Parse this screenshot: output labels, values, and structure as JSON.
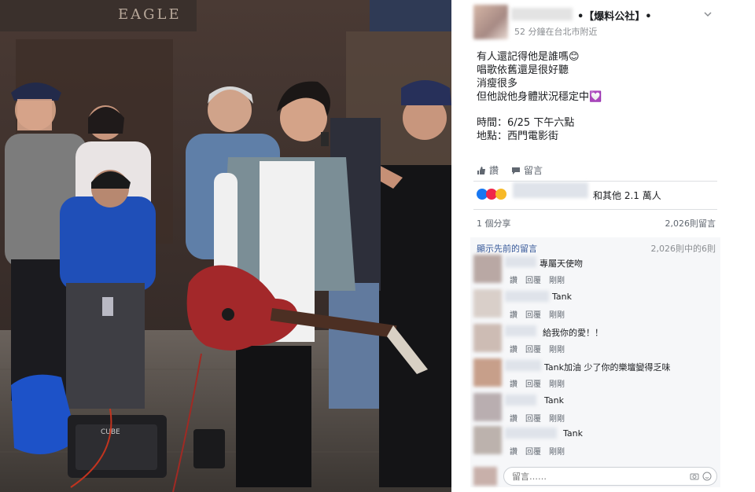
{
  "post": {
    "page_name": "•【爆料公社】•",
    "meta": "52 分鐘在台北市附近",
    "body_lines": [
      "有人還記得他是誰嗎😊",
      "唱歌依舊還是很好聽",
      "消瘦很多",
      "但他說他身體狀況穩定中💟"
    ],
    "event_lines": [
      "時間：6/25 下午六點",
      "地點：西門電影街"
    ],
    "actions": {
      "like": "讚",
      "comment": "留言"
    },
    "reactions_text": "和其他 2.1 萬人",
    "shares": "1 個分享",
    "comment_count": "2,026則留言",
    "previous_comments_link": "顯示先前的留言",
    "comment_progress": "2,026則中的6則",
    "comments": [
      {
        "text": "專屬天使吻"
      },
      {
        "text": "Tank"
      },
      {
        "text": "給我你的愛！！"
      },
      {
        "text": "Tank加油 少了你的樂壇變得乏味"
      },
      {
        "text": "Tank"
      },
      {
        "text": "Tank"
      }
    ],
    "comment_action_labels": [
      "讚",
      "回覆",
      "剛剛"
    ],
    "input_placeholder": "留言……"
  },
  "photo": {
    "sign_text": "EAGLE",
    "amp_brand": "CUBE"
  },
  "colors": {
    "facebook_link": "#365899",
    "reaction_like": "#1877f2",
    "reaction_love": "#f0284a",
    "reaction_haha": "#f7b928",
    "guitar_red": "#a3282a",
    "bag_blue": "#1d52c8"
  }
}
